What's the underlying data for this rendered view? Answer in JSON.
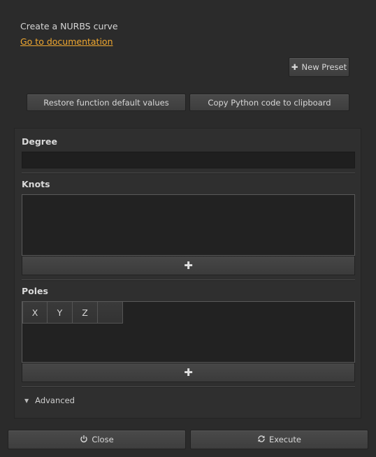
{
  "header": {
    "description": "Create a NURBS curve",
    "doc_link": "Go to documentation"
  },
  "toolbar": {
    "new_preset_label": "New Preset",
    "restore_label": "Restore function default values",
    "copy_label": "Copy Python code to clipboard"
  },
  "form": {
    "degree_label": "Degree",
    "degree_value": "",
    "knots_label": "Knots",
    "poles_label": "Poles",
    "poles_columns": [
      "X",
      "Y",
      "Z",
      ""
    ],
    "add_glyph": "✚",
    "advanced_label": "Advanced"
  },
  "footer": {
    "close_label": "Close",
    "execute_label": "Execute"
  },
  "colors": {
    "background": "#2b2b2b",
    "link": "#f0a830"
  },
  "icons": {
    "new_preset": "plus-icon",
    "close": "power-icon",
    "execute": "refresh-icon",
    "advanced": "triangle-down-icon"
  }
}
